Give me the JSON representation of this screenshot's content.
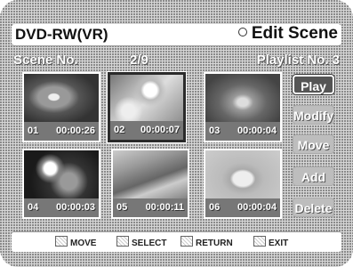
{
  "header": {
    "app_title": "DVD-RW(VR)",
    "mode_title": "Edit Scene"
  },
  "info": {
    "scene_label": "Scene No.",
    "scene_counter": "2/9",
    "playlist_label": "Playlist No. 3"
  },
  "thumbnails": [
    {
      "number": "01",
      "time": "00:00:26"
    },
    {
      "number": "02",
      "time": "00:00:07"
    },
    {
      "number": "03",
      "time": "00:00:04"
    },
    {
      "number": "04",
      "time": "00:00:03"
    },
    {
      "number": "05",
      "time": "00:00:11"
    },
    {
      "number": "06",
      "time": "00:00:04"
    }
  ],
  "actions": {
    "play": "Play",
    "modify": "Modify",
    "move": "Move",
    "add": "Add",
    "delete": "Delete"
  },
  "footer": {
    "move": "MOVE",
    "select": "SELECT",
    "return": "RETURN",
    "exit": "EXIT"
  },
  "colors": {
    "panel": "#d7d7d7",
    "active_button": "#555555"
  }
}
